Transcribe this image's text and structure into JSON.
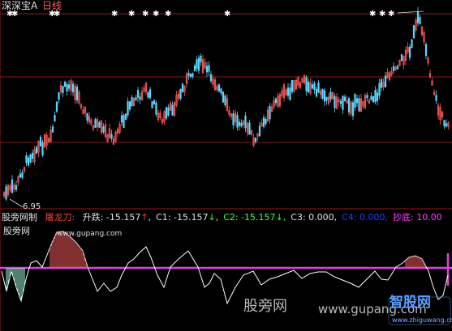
{
  "header": {
    "stock_name": "深深宝A",
    "period": "日线"
  },
  "main_chart": {
    "low_price_label": "6.95",
    "colors": {
      "up": "#ff5a5a",
      "down": "#5ad8ff",
      "grid": "#8b1a1a",
      "marker": "#ffffff"
    }
  },
  "indicator": {
    "name_label": "股旁网制",
    "formula_name": "屠龙刀:",
    "fields": [
      {
        "label": "升跌:",
        "value": "-15.157",
        "arrow": "↑",
        "label_color": "#e0e0e0",
        "value_color": "#e0e0e0",
        "arrow_color": "#ff4040"
      },
      {
        "label": "C1:",
        "value": "-15.157",
        "arrow": "↓",
        "label_color": "#e0e0e0",
        "value_color": "#e0e0e0",
        "arrow_color": "#40ff40"
      },
      {
        "label": "C2:",
        "value": "-15.157",
        "arrow": "↓",
        "label_color": "#40ff40",
        "value_color": "#40ff40",
        "arrow_color": "#40ff40"
      },
      {
        "label": "C3:",
        "value": "0.000,",
        "arrow": "",
        "label_color": "#e0e0e0",
        "value_color": "#e0e0e0",
        "arrow_color": "#e0e0e0"
      },
      {
        "label": "C4:",
        "value": "0.000,",
        "arrow": "",
        "label_color": "#2040ff",
        "value_color": "#2040ff",
        "arrow_color": "#2040ff"
      },
      {
        "label": "抄底:",
        "value": "10.00",
        "arrow": "",
        "label_color": "#ff40ff",
        "value_color": "#ff40ff",
        "arrow_color": "#ff40ff"
      }
    ],
    "site_label": "股旁网",
    "site_url": "www.gupang.com",
    "colors": {
      "line": "#ffffff",
      "baseline": "#e040e0",
      "bars": "#ff6060",
      "bars_low": "#a0ffe0"
    }
  },
  "watermarks": {
    "cn_text": "股旁网",
    "url_text": "www.gupang.com",
    "brand_cn": "智股网",
    "brand_url": "www.zhiguwang.cn"
  }
}
